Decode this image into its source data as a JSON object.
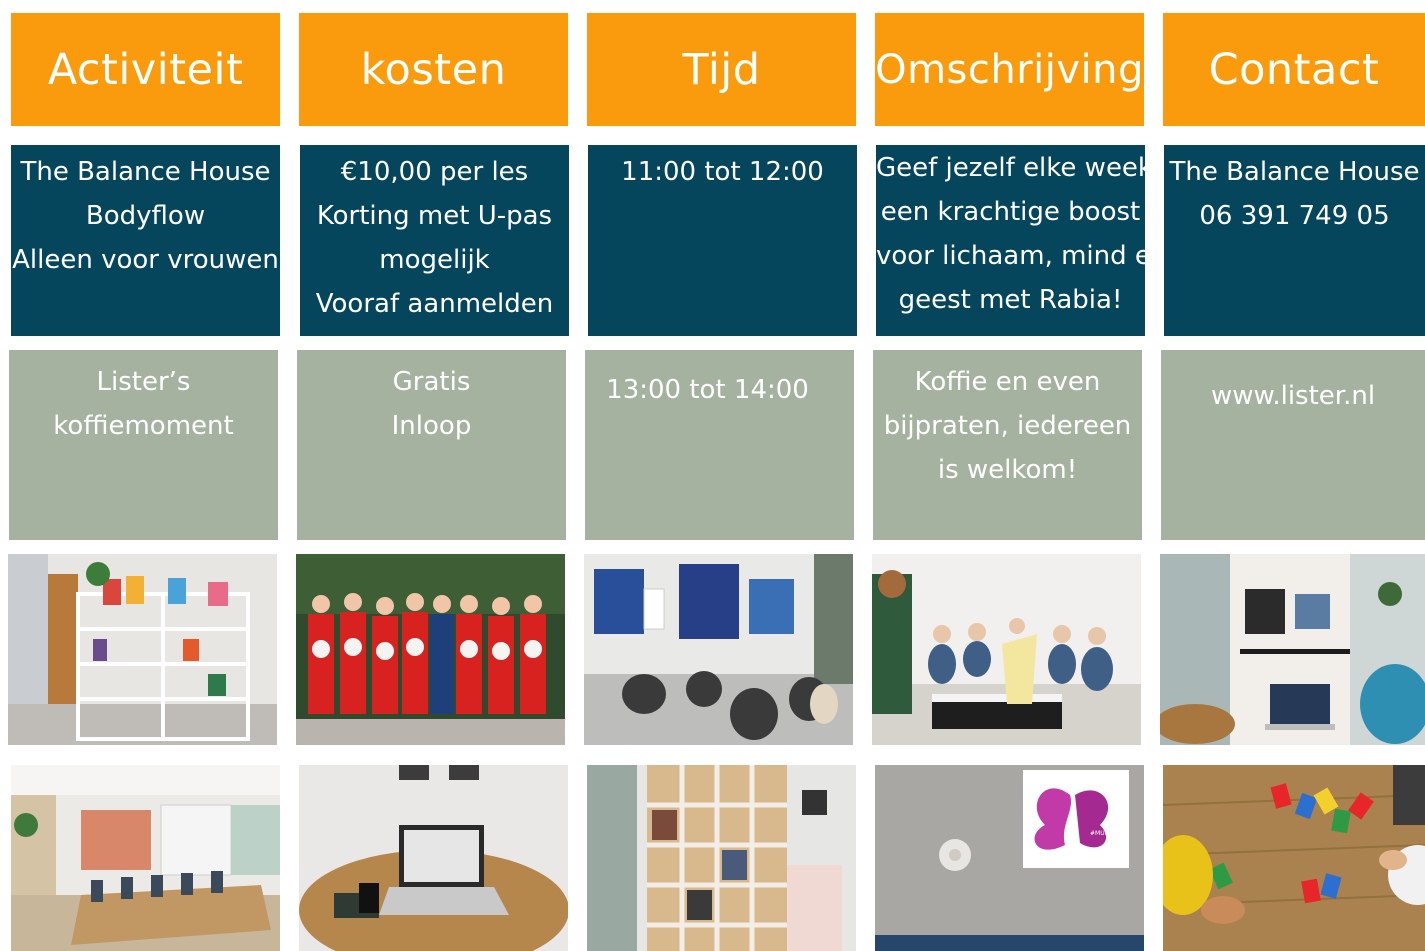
{
  "headers": {
    "activity": "Activiteit",
    "cost": "kosten",
    "time": "Tijd",
    "description": "Omschrijving",
    "contact": "Contact"
  },
  "rows": [
    {
      "activity": [
        "The Balance House",
        "Bodyflow",
        "Alleen voor vrouwen"
      ],
      "cost": [
        "€10,00 per les",
        "Korting met U-pas",
        "mogelijk",
        "Vooraf aanmelden"
      ],
      "time": [
        "11:00 tot 12:00"
      ],
      "description": [
        "Geef jezelf elke week",
        "een krachtige boost",
        "voor lichaam, mind en",
        "geest met Rabia!"
      ],
      "contact": [
        "The Balance House",
        "06 391 749 05"
      ]
    },
    {
      "activity": [
        "Lister’s",
        "koffiemoment"
      ],
      "cost": [
        "Gratis",
        "Inloop"
      ],
      "time": [
        "13:00 tot 14:00"
      ],
      "description": [
        "Koffie en even",
        "bijpraten, iedereen",
        "is welkom!"
      ],
      "contact": [
        "www.lister.nl"
      ]
    }
  ],
  "photos": [
    "bookshelf-photo",
    "dancers-photo",
    "classroom-photo",
    "music-group-photo",
    "workstation-photo",
    "community-room-photo",
    "laptop-table-photo",
    "cubby-shelf-photo",
    "butterfly-poster-photo",
    "card-game-photo"
  ],
  "poster_text": "#MUPNL",
  "colors": {
    "header": "#f99b0c",
    "row_dark": "#05465c",
    "row_sage": "#a5b29f"
  }
}
